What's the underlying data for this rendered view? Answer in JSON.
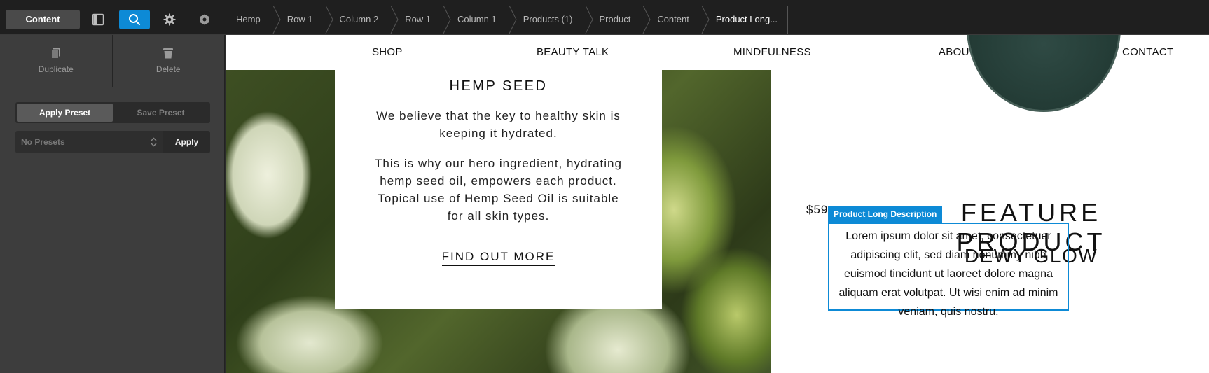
{
  "topbar": {
    "content_tab": "Content",
    "breadcrumbs": [
      "Hemp",
      "Row 1",
      "Column 2",
      "Row 1",
      "Column 1",
      "Products (1)",
      "Product",
      "Content",
      "Product Long..."
    ]
  },
  "sidebar": {
    "duplicate_label": "Duplicate",
    "delete_label": "Delete",
    "apply_preset_label": "Apply Preset",
    "save_preset_label": "Save Preset",
    "presets_value": "No Presets",
    "apply_label": "Apply"
  },
  "nav": {
    "shop": "SHOP",
    "beauty": "BEAUTY TALK",
    "mindfulness": "MINDFULNESS",
    "about": "ABOUT",
    "contact": "CONTACT"
  },
  "hemp": {
    "title": "HEMP SEED",
    "para1": "We believe that the key to healthy skin is keeping it hydrated.",
    "para2": "This is why our hero ingredient, hydrating hemp seed oil, empowers each product. Topical use of Hemp Seed Oil is suitable for all skin types.",
    "link": "FIND OUT MORE"
  },
  "feature": {
    "title": "FEATURE PRODUCT",
    "product_name": "DEWY GLOW",
    "price": "$59",
    "selected_label": "Product Long Description",
    "description": "Lorem ipsum dolor sit amet, consectetuer adipiscing elit, sed diam nonummy nibh euismod tincidunt ut laoreet dolore magna aliquam erat volutpat. Ut wisi enim ad minim veniam, quis nostru."
  },
  "colors": {
    "accent": "#0d8ad6",
    "topbar_bg": "#1f1f1f",
    "sidebar_bg": "#3d3d3d"
  }
}
